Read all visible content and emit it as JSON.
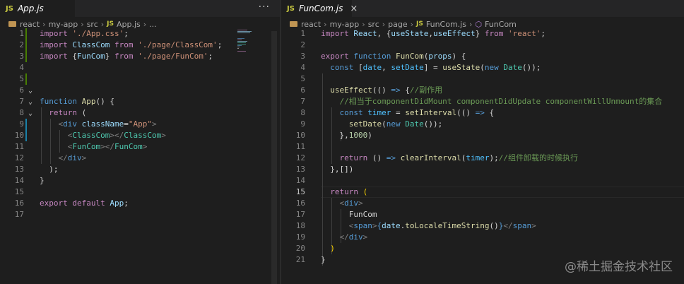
{
  "left_tab": {
    "icon": "JS",
    "label": "App.js",
    "more": "···"
  },
  "left_breadcrumb": [
    "react",
    "my-app",
    "src",
    "App.js",
    "..."
  ],
  "left_lines": [
    {
      "n": "1",
      "segs": [
        [
          "k",
          "import "
        ],
        [
          "s",
          "'./App.css'"
        ],
        [
          "p",
          ";"
        ]
      ]
    },
    {
      "n": "2",
      "segs": [
        [
          "k",
          "import "
        ],
        [
          "v",
          "ClassCom"
        ],
        [
          "k",
          " from "
        ],
        [
          "s",
          "'./page/ClassCom'"
        ],
        [
          "p",
          ";"
        ]
      ]
    },
    {
      "n": "3",
      "segs": [
        [
          "k",
          "import "
        ],
        [
          "p",
          "{"
        ],
        [
          "v",
          "FunCom"
        ],
        [
          "p",
          "} "
        ],
        [
          "k",
          "from "
        ],
        [
          "s",
          "'./page/FunCom'"
        ],
        [
          "p",
          ";"
        ]
      ]
    },
    {
      "n": "4",
      "segs": []
    },
    {
      "n": "5",
      "segs": []
    },
    {
      "n": "6",
      "segs": []
    },
    {
      "n": "7",
      "segs": [
        [
          "b",
          "function "
        ],
        [
          "f",
          "App"
        ],
        [
          "p",
          "() {"
        ]
      ]
    },
    {
      "n": "8",
      "segs": [
        [
          "p",
          "  "
        ],
        [
          "k",
          "return"
        ],
        [
          "p",
          " ("
        ]
      ]
    },
    {
      "n": "9",
      "segs": [
        [
          "p",
          "    "
        ],
        [
          "g",
          "<"
        ],
        [
          "b",
          "div "
        ],
        [
          "v",
          "className"
        ],
        [
          "p",
          "="
        ],
        [
          "s",
          "\"App\""
        ],
        [
          "g",
          ">"
        ]
      ]
    },
    {
      "n": "10",
      "segs": [
        [
          "p",
          "      "
        ],
        [
          "g",
          "<"
        ],
        [
          "t",
          "ClassCom"
        ],
        [
          "g",
          "></"
        ],
        [
          "t",
          "ClassCom"
        ],
        [
          "g",
          ">"
        ]
      ]
    },
    {
      "n": "11",
      "segs": [
        [
          "p",
          "      "
        ],
        [
          "g",
          "<"
        ],
        [
          "t",
          "FunCom"
        ],
        [
          "g",
          "></"
        ],
        [
          "t",
          "FunCom"
        ],
        [
          "g",
          ">"
        ]
      ]
    },
    {
      "n": "12",
      "segs": [
        [
          "p",
          "    "
        ],
        [
          "g",
          "</"
        ],
        [
          "b",
          "div"
        ],
        [
          "g",
          ">"
        ]
      ]
    },
    {
      "n": "13",
      "segs": [
        [
          "p",
          "  );"
        ]
      ]
    },
    {
      "n": "14",
      "segs": [
        [
          "p",
          "}"
        ]
      ]
    },
    {
      "n": "15",
      "segs": []
    },
    {
      "n": "16",
      "segs": [
        [
          "k",
          "export default "
        ],
        [
          "v",
          "App"
        ],
        [
          "p",
          ";"
        ]
      ]
    },
    {
      "n": "17",
      "segs": []
    }
  ],
  "right_tab": {
    "icon": "JS",
    "label": "FunCom.js",
    "close": "×"
  },
  "right_breadcrumb": [
    "react",
    "my-app",
    "src",
    "page",
    "FunCom.js",
    "FunCom"
  ],
  "right_lines": [
    {
      "n": "1",
      "segs": [
        [
          "k",
          "import "
        ],
        [
          "v",
          "React"
        ],
        [
          "p",
          ", {"
        ],
        [
          "v",
          "useState"
        ],
        [
          "p",
          ","
        ],
        [
          "v",
          "useEffect"
        ],
        [
          "p",
          "} "
        ],
        [
          "k",
          "from "
        ],
        [
          "s",
          "'react'"
        ],
        [
          "p",
          ";"
        ]
      ]
    },
    {
      "n": "2",
      "segs": []
    },
    {
      "n": "3",
      "segs": [
        [
          "k",
          "export "
        ],
        [
          "b",
          "function "
        ],
        [
          "f",
          "FunCom"
        ],
        [
          "p",
          "("
        ],
        [
          "v",
          "props"
        ],
        [
          "p",
          ") {"
        ]
      ]
    },
    {
      "n": "4",
      "segs": [
        [
          "p",
          "  "
        ],
        [
          "b",
          "const "
        ],
        [
          "p",
          "["
        ],
        [
          "c",
          "date"
        ],
        [
          "p",
          ", "
        ],
        [
          "c",
          "setDate"
        ],
        [
          "p",
          "] = "
        ],
        [
          "f",
          "useState"
        ],
        [
          "p",
          "("
        ],
        [
          "b",
          "new "
        ],
        [
          "t",
          "Date"
        ],
        [
          "p",
          "());"
        ]
      ]
    },
    {
      "n": "5",
      "segs": []
    },
    {
      "n": "6",
      "segs": [
        [
          "p",
          "  "
        ],
        [
          "f",
          "useEffect"
        ],
        [
          "p",
          "(() "
        ],
        [
          "b",
          "=>"
        ],
        [
          "p",
          " {"
        ],
        [
          "cm",
          "//副作用"
        ]
      ]
    },
    {
      "n": "7",
      "segs": [
        [
          "p",
          "    "
        ],
        [
          "cm",
          "//相当于componentDidMount componentDidUpdate componentWillUnmount的集合"
        ]
      ]
    },
    {
      "n": "8",
      "segs": [
        [
          "p",
          "    "
        ],
        [
          "b",
          "const "
        ],
        [
          "c",
          "timer"
        ],
        [
          "p",
          " = "
        ],
        [
          "f",
          "setInterval"
        ],
        [
          "p",
          "(() "
        ],
        [
          "b",
          "=>"
        ],
        [
          "p",
          " {"
        ]
      ]
    },
    {
      "n": "9",
      "segs": [
        [
          "p",
          "      "
        ],
        [
          "f",
          "setDate"
        ],
        [
          "p",
          "("
        ],
        [
          "b",
          "new "
        ],
        [
          "t",
          "Date"
        ],
        [
          "p",
          "());"
        ]
      ]
    },
    {
      "n": "10",
      "segs": [
        [
          "p",
          "    },"
        ],
        [
          "n",
          "1000"
        ],
        [
          "p",
          ")"
        ]
      ]
    },
    {
      "n": "11",
      "segs": []
    },
    {
      "n": "12",
      "segs": [
        [
          "p",
          "    "
        ],
        [
          "k",
          "return"
        ],
        [
          "p",
          " () "
        ],
        [
          "b",
          "=>"
        ],
        [
          "p",
          " "
        ],
        [
          "f",
          "clearInterval"
        ],
        [
          "p",
          "("
        ],
        [
          "c",
          "timer"
        ],
        [
          "p",
          ");"
        ],
        [
          "cm",
          "//组件卸载的时候执行"
        ]
      ]
    },
    {
      "n": "13",
      "segs": [
        [
          "p",
          "  },[])"
        ]
      ]
    },
    {
      "n": "14",
      "segs": []
    },
    {
      "n": "15",
      "segs": [
        [
          "p",
          "  "
        ],
        [
          "k",
          "return"
        ],
        [
          "p",
          " "
        ],
        [
          "y",
          "("
        ]
      ]
    },
    {
      "n": "16",
      "segs": [
        [
          "p",
          "    "
        ],
        [
          "g",
          "<"
        ],
        [
          "b",
          "div"
        ],
        [
          "g",
          ">"
        ]
      ]
    },
    {
      "n": "17",
      "segs": [
        [
          "p",
          "      FunCom"
        ]
      ]
    },
    {
      "n": "18",
      "segs": [
        [
          "p",
          "      "
        ],
        [
          "g",
          "<"
        ],
        [
          "b",
          "span"
        ],
        [
          "g",
          ">"
        ],
        [
          "b",
          "{"
        ],
        [
          "v",
          "date"
        ],
        [
          "p",
          "."
        ],
        [
          "f",
          "toLocaleTimeString"
        ],
        [
          "p",
          "()"
        ],
        [
          "b",
          "}"
        ],
        [
          "g",
          "</"
        ],
        [
          "b",
          "span"
        ],
        [
          "g",
          ">"
        ]
      ]
    },
    {
      "n": "19",
      "segs": [
        [
          "p",
          "    "
        ],
        [
          "g",
          "</"
        ],
        [
          "b",
          "div"
        ],
        [
          "g",
          ">"
        ]
      ]
    },
    {
      "n": "20",
      "segs": [
        [
          "p",
          "  "
        ],
        [
          "y",
          ")"
        ]
      ]
    },
    {
      "n": "21",
      "segs": [
        [
          "p",
          "}"
        ]
      ]
    }
  ],
  "watermark": "@稀土掘金技术社区"
}
